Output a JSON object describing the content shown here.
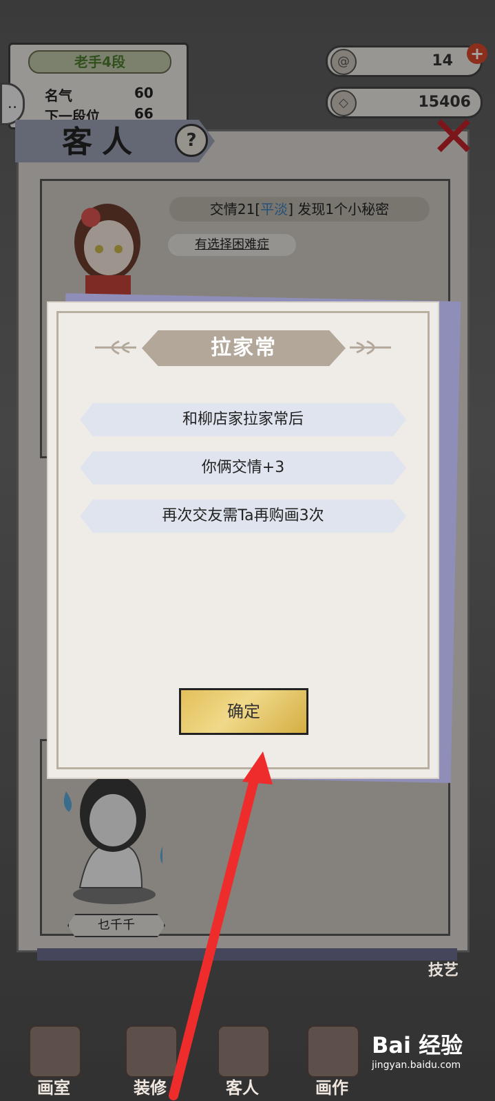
{
  "hud": {
    "rank": "老手4段",
    "fame_label": "名气",
    "fame_value": "60",
    "next_label": "下一段位",
    "next_value": "66",
    "resource1": "14",
    "resource2": "15406",
    "resource1_icon": "swirl-icon",
    "resource2_icon": "coin-icon"
  },
  "panel": {
    "title": "客人",
    "help_icon": "?",
    "close_icon": "✕"
  },
  "guest1": {
    "friendship_prefix": "交情21[",
    "mood": "平淡",
    "friendship_suffix": "] 发现1个小秘密",
    "trait": "有选择困难症"
  },
  "guest2": {
    "name": "乜千千"
  },
  "dialog": {
    "title": "拉家常",
    "lines": [
      "和柳店家拉家常后",
      "你俩交情+3",
      "再次交友需Ta再购画3次"
    ],
    "confirm": "确定"
  },
  "nav": {
    "items": [
      "画室",
      "装修",
      "客人",
      "画作"
    ],
    "skill": "技艺"
  },
  "watermark": {
    "logo": "Bai 经验",
    "url": "jingyan.baidu.com"
  },
  "colors": {
    "accent_red": "#d8482c",
    "mood_blue": "#3b7cb8",
    "button_gold": "#e3c05a"
  }
}
